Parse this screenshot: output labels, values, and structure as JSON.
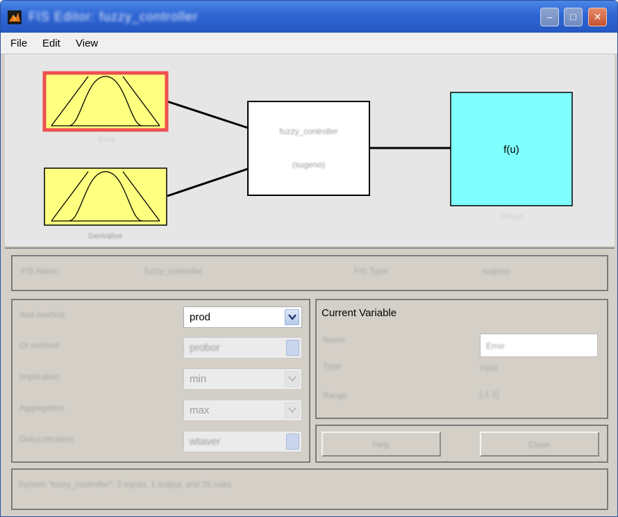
{
  "window": {
    "title": "FIS Editor: fuzzy_controller",
    "colors": {
      "titlebar": "#2f66d4",
      "input_mf": "#ffff80",
      "selected_border": "#ee5050",
      "output_box": "#80ffff"
    }
  },
  "title_buttons": {
    "minimize": "–",
    "maximize": "□",
    "close": "✕"
  },
  "menu": {
    "file": "File",
    "edit": "Edit",
    "view": "View"
  },
  "diagram": {
    "input1_label": "Error",
    "input2_label": "Derivative",
    "rules_line1": "fuzzy_controller",
    "rules_line2": "(sugeno)",
    "output_function": "f(u)",
    "output_label": "Output"
  },
  "info_bar": {
    "fis_name_label": "FIS Name:",
    "fis_name_value": "fuzzy_controller",
    "fis_type_label": "FIS Type:",
    "fis_type_value": "sugeno"
  },
  "methods": {
    "and_label": "And method",
    "and_value": "prod",
    "or_label": "Or method",
    "or_value": "probor",
    "implication_label": "Implication",
    "implication_value": "min",
    "aggregation_label": "Aggregation",
    "aggregation_value": "max",
    "defuzz_label": "Defuzzification",
    "defuzz_value": "wtaver"
  },
  "current_variable": {
    "title": "Current Variable",
    "name_label": "Name",
    "name_value": "Error",
    "type_label": "Type",
    "type_value": "input",
    "range_label": "Range",
    "range_value": "[-1 1]"
  },
  "buttons": {
    "help": "Help",
    "close": "Close"
  },
  "status": {
    "text": "System \"fuzzy_controller\": 2 inputs, 1 output, and 25 rules"
  }
}
